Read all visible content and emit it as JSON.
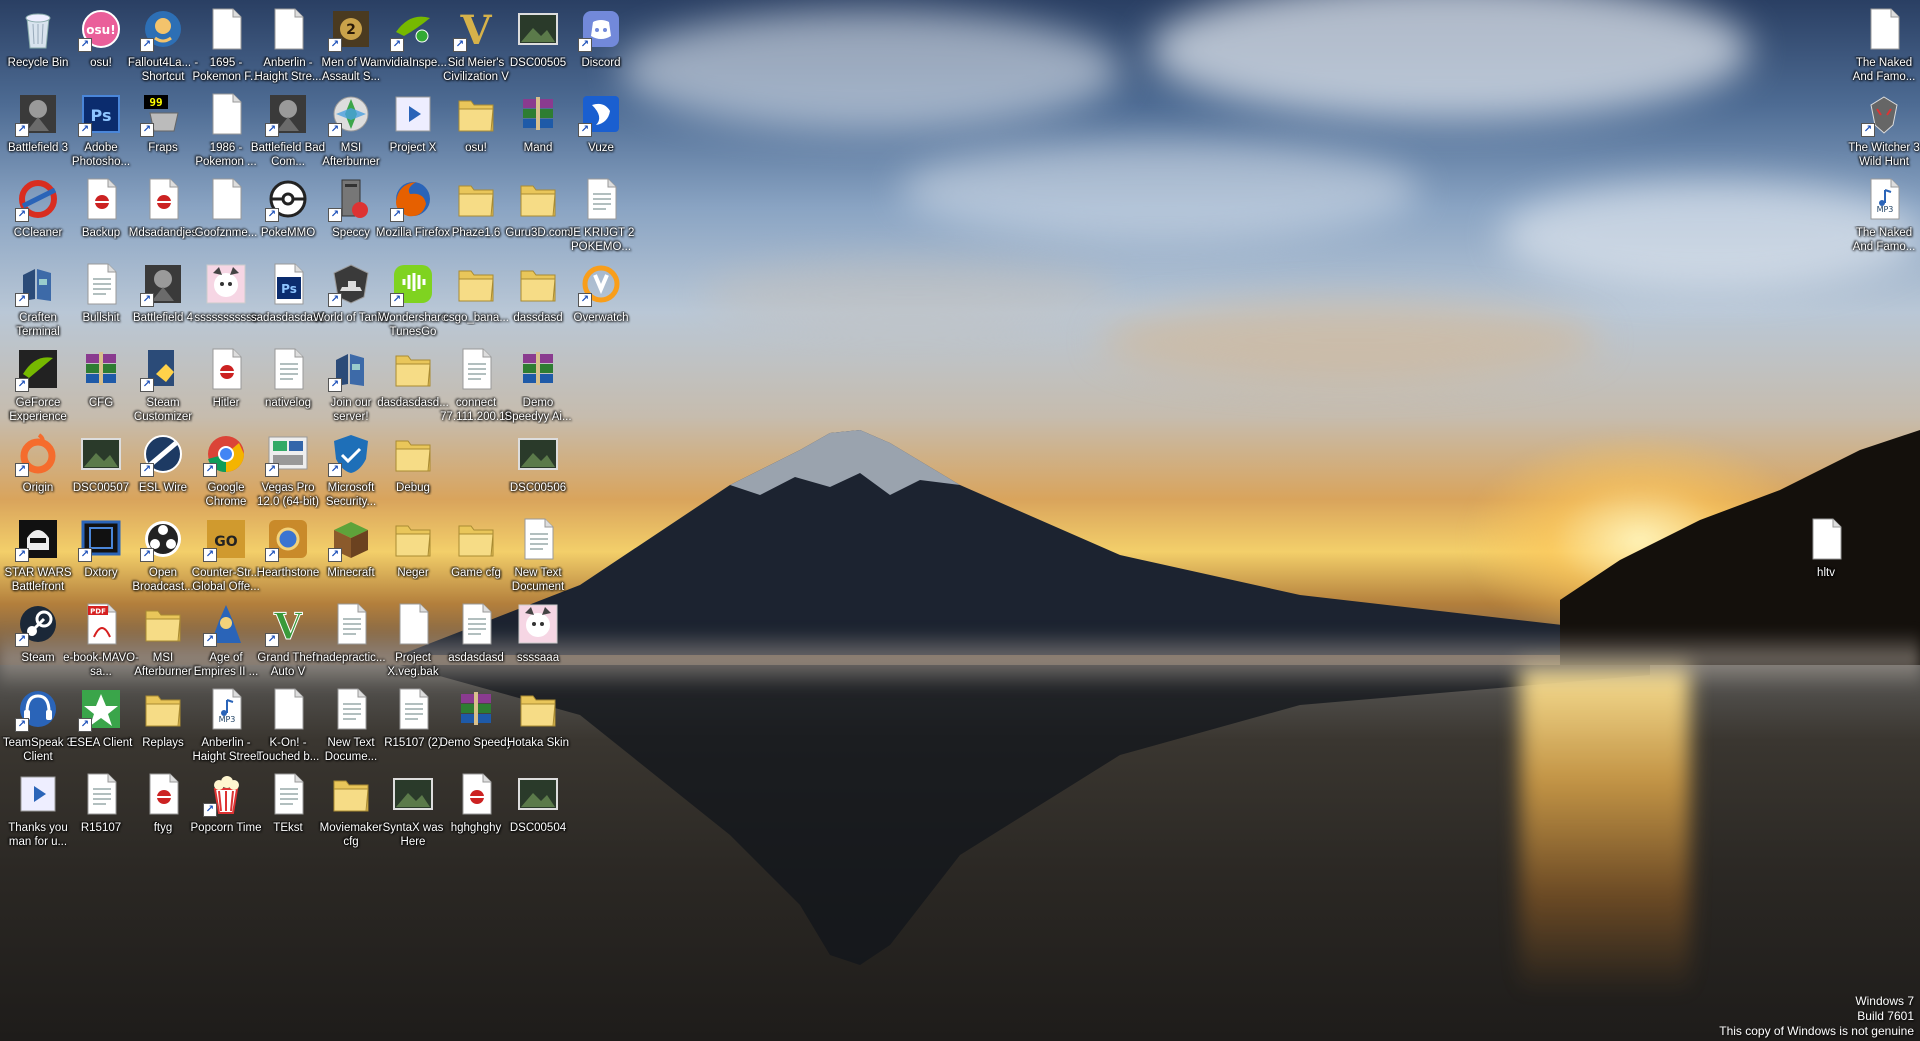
{
  "desktop": {
    "icons": [
      {
        "label": "Recycle Bin",
        "icon": "recycle-bin-icon",
        "shortcut": false
      },
      {
        "label": "osu!",
        "icon": "osu-icon",
        "shortcut": true
      },
      {
        "label": "Fallout4La... - Shortcut",
        "icon": "fallout-icon",
        "shortcut": true
      },
      {
        "label": "1695 - Pokemon F...",
        "icon": "document-icon",
        "shortcut": false
      },
      {
        "label": "Anberlin - Haight Stre...",
        "icon": "document-icon",
        "shortcut": false
      },
      {
        "label": "Men of War Assault S...",
        "icon": "men-of-war-icon",
        "shortcut": true
      },
      {
        "label": "nvidiaInspe...",
        "icon": "nvidia-inspector-icon",
        "shortcut": true
      },
      {
        "label": "Sid Meier's Civilization V",
        "icon": "civilization-icon",
        "shortcut": true
      },
      {
        "label": "DSC00505",
        "icon": "photo-icon",
        "shortcut": false
      },
      {
        "label": "Discord",
        "icon": "discord-icon",
        "shortcut": true
      },
      {
        "label": "Battlefield 3",
        "icon": "battlefield-icon",
        "shortcut": true
      },
      {
        "label": "Adobe Photosho...",
        "icon": "photoshop-icon",
        "shortcut": true
      },
      {
        "label": "Fraps",
        "icon": "fraps-icon",
        "shortcut": true
      },
      {
        "label": "1986 - Pokemon ...",
        "icon": "document-icon",
        "shortcut": false
      },
      {
        "label": "Battlefield Bad Com...",
        "icon": "battlefield-icon",
        "shortcut": true
      },
      {
        "label": "MSI Afterburner",
        "icon": "msi-afterburner-icon",
        "shortcut": true
      },
      {
        "label": "Project X",
        "icon": "video-file-icon",
        "shortcut": false
      },
      {
        "label": "osu!",
        "icon": "folder-icon",
        "shortcut": false
      },
      {
        "label": "Mand",
        "icon": "winrar-icon",
        "shortcut": false
      },
      {
        "label": "Vuze",
        "icon": "vuze-icon",
        "shortcut": true
      },
      {
        "label": "CCleaner",
        "icon": "ccleaner-icon",
        "shortcut": true
      },
      {
        "label": "Backup",
        "icon": "backup-icon",
        "shortcut": false
      },
      {
        "label": "Mdsadandjes",
        "icon": "backup-icon",
        "shortcut": false
      },
      {
        "label": "Goofznme...",
        "icon": "document-icon",
        "shortcut": false
      },
      {
        "label": "PokeMMO",
        "icon": "pokemmo-icon",
        "shortcut": true
      },
      {
        "label": "Speccy",
        "icon": "speccy-icon",
        "shortcut": true
      },
      {
        "label": "Mozilla Firefox",
        "icon": "firefox-icon",
        "shortcut": true
      },
      {
        "label": "Phaze1.6",
        "icon": "folder-icon",
        "shortcut": false
      },
      {
        "label": "Guru3D.com",
        "icon": "folder-icon",
        "shortcut": false
      },
      {
        "label": "JE KRIJGT 2 POKEMO...",
        "icon": "text-file-icon",
        "shortcut": false
      },
      {
        "label": "Craften Terminal",
        "icon": "craften-icon",
        "shortcut": true
      },
      {
        "label": "Bullshit",
        "icon": "text-file-icon",
        "shortcut": false
      },
      {
        "label": "Battlefield 4",
        "icon": "battlefield-icon",
        "shortcut": true
      },
      {
        "label": "sssssssssss",
        "icon": "anime-image-icon",
        "shortcut": false
      },
      {
        "label": "sadasdasdasd",
        "icon": "psd-file-icon",
        "shortcut": false
      },
      {
        "label": "World of Tanks",
        "icon": "world-of-tanks-icon",
        "shortcut": true
      },
      {
        "label": "Wondershare TunesGo",
        "icon": "tunesgo-icon",
        "shortcut": true
      },
      {
        "label": "csgo_bana...",
        "icon": "folder-icon",
        "shortcut": false
      },
      {
        "label": "dassdasd",
        "icon": "folder-icon",
        "shortcut": false
      },
      {
        "label": "Overwatch",
        "icon": "overwatch-icon",
        "shortcut": true
      },
      {
        "label": "GeForce Experience",
        "icon": "geforce-icon",
        "shortcut": true
      },
      {
        "label": "CFG",
        "icon": "winrar-icon",
        "shortcut": false
      },
      {
        "label": "Steam Customizer",
        "icon": "steam-customizer-icon",
        "shortcut": true
      },
      {
        "label": "Hitler",
        "icon": "backup-icon",
        "shortcut": false
      },
      {
        "label": "nativelog",
        "icon": "text-file-icon",
        "shortcut": false
      },
      {
        "label": "Join our server!",
        "icon": "craften-icon",
        "shortcut": true
      },
      {
        "label": "dasdasdasd...",
        "icon": "folder-icon",
        "shortcut": false
      },
      {
        "label": "connect 77.111.200.10",
        "icon": "text-file-icon",
        "shortcut": false
      },
      {
        "label": "Demo Speedyy Ai...",
        "icon": "winrar-icon",
        "shortcut": false
      },
      null,
      {
        "label": "Origin",
        "icon": "origin-icon",
        "shortcut": true
      },
      {
        "label": "DSC00507",
        "icon": "photo-icon",
        "shortcut": false
      },
      {
        "label": "ESL Wire",
        "icon": "esl-wire-icon",
        "shortcut": true
      },
      {
        "label": "Google Chrome",
        "icon": "chrome-icon",
        "shortcut": true
      },
      {
        "label": "Vegas Pro 12.0 (64-bit)",
        "icon": "vegas-icon",
        "shortcut": true
      },
      {
        "label": "Microsoft Security...",
        "icon": "security-icon",
        "shortcut": true
      },
      {
        "label": "Debug",
        "icon": "folder-icon",
        "shortcut": false
      },
      null,
      {
        "label": "DSC00506",
        "icon": "photo-icon",
        "shortcut": false
      },
      null,
      {
        "label": "STAR WARS Battlefront",
        "icon": "star-wars-icon",
        "shortcut": true
      },
      {
        "label": "Dxtory",
        "icon": "dxtory-icon",
        "shortcut": true
      },
      {
        "label": "Open Broadcast...",
        "icon": "obs-icon",
        "shortcut": true
      },
      {
        "label": "Counter-Str... Global Offe...",
        "icon": "csgo-icon",
        "shortcut": true
      },
      {
        "label": "Hearthstone",
        "icon": "hearthstone-icon",
        "shortcut": true
      },
      {
        "label": "Minecraft",
        "icon": "minecraft-icon",
        "shortcut": true
      },
      {
        "label": "Neger",
        "icon": "folder-icon",
        "shortcut": false
      },
      {
        "label": "Game cfg",
        "icon": "folder-icon",
        "shortcut": false
      },
      {
        "label": "New Text Document",
        "icon": "text-file-icon",
        "shortcut": false
      },
      null,
      {
        "label": "Steam",
        "icon": "steam-icon",
        "shortcut": true
      },
      {
        "label": "e-book-MAVO-sa...",
        "icon": "pdf-icon",
        "shortcut": false
      },
      {
        "label": "MSI Afterburner",
        "icon": "folder-icon",
        "shortcut": false
      },
      {
        "label": "Age of Empires II ...",
        "icon": "age-of-empires-icon",
        "shortcut": true
      },
      {
        "label": "Grand Theft Auto V",
        "icon": "gta-icon",
        "shortcut": true
      },
      {
        "label": "nadepractic...",
        "icon": "text-file-icon",
        "shortcut": false
      },
      {
        "label": "Project X.veg.bak",
        "icon": "document-icon",
        "shortcut": false
      },
      {
        "label": "asdasdasd",
        "icon": "text-file-icon",
        "shortcut": false
      },
      {
        "label": "ssssaaa",
        "icon": "anime-image-icon",
        "shortcut": false
      },
      null,
      {
        "label": "TeamSpeak 3 Client",
        "icon": "teamspeak-icon",
        "shortcut": true
      },
      {
        "label": "ESEA Client",
        "icon": "esea-icon",
        "shortcut": true
      },
      {
        "label": "Replays",
        "icon": "folder-icon",
        "shortcut": false
      },
      {
        "label": "Anberlin - Haight Street",
        "icon": "mp3-file-icon",
        "shortcut": false
      },
      {
        "label": "K-On! - Touched b...",
        "icon": "document-icon",
        "shortcut": false
      },
      {
        "label": "New Text Docume...",
        "icon": "text-file-icon",
        "shortcut": false
      },
      {
        "label": "R15107 (2)",
        "icon": "text-file-icon",
        "shortcut": false
      },
      {
        "label": "Demo Speedy",
        "icon": "winrar-icon",
        "shortcut": false
      },
      {
        "label": "Hotaka Skin",
        "icon": "folder-icon",
        "shortcut": false
      },
      null,
      {
        "label": "Thanks you man for u...",
        "icon": "video-file-icon",
        "shortcut": false
      },
      {
        "label": "R15107",
        "icon": "text-file-icon",
        "shortcut": false
      },
      {
        "label": "ftyg",
        "icon": "backup-icon",
        "shortcut": false
      },
      {
        "label": "Popcorn Time",
        "icon": "popcorn-icon",
        "shortcut": true
      },
      {
        "label": "TEkst",
        "icon": "text-file-icon",
        "shortcut": false
      },
      {
        "label": "Moviemaker cfg",
        "icon": "folder-icon",
        "shortcut": false
      },
      {
        "label": "SyntaX was Here",
        "icon": "photo-icon",
        "shortcut": false
      },
      {
        "label": "hghghghy",
        "icon": "backup-icon",
        "shortcut": false
      },
      {
        "label": "DSC00504",
        "icon": "photo-icon",
        "shortcut": false
      },
      null
    ],
    "right_icons": [
      {
        "label": "The Naked And Famo...",
        "icon": "document-icon",
        "shortcut": false
      },
      {
        "label": "The Witcher 3 Wild Hunt",
        "icon": "witcher-icon",
        "shortcut": true
      },
      {
        "label": "The Naked And Famo...",
        "icon": "mp3-file-icon",
        "shortcut": false
      }
    ],
    "loose_icon": {
      "label": "hltv",
      "icon": "document-icon",
      "shortcut": false
    }
  },
  "watermark": {
    "line1": "Windows 7",
    "line2": "Build 7601",
    "line3": "This copy of Windows is not genuine"
  },
  "colors": {
    "folder": "#e9c65a",
    "document": "#ffffff",
    "winrar": "#8a3b8f",
    "label_text": "#ffffff"
  }
}
